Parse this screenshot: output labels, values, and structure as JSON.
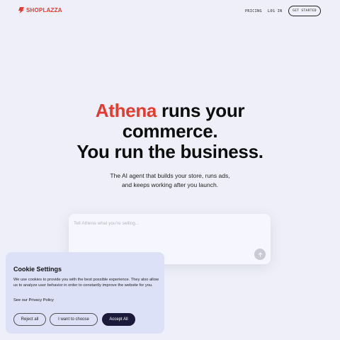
{
  "header": {
    "logo_text": "SHOPLAZZA",
    "logo_icon": "shoplazza-bolt-icon",
    "nav": {
      "pricing": "PRICING",
      "login": "LOG IN",
      "cta": "GET STARTED"
    }
  },
  "hero": {
    "accent": "Athena",
    "line1_rest": " runs your",
    "line2": "commerce.",
    "line3": "You run the business.",
    "subtitle_line1": "The AI agent that builds your store, runs ads,",
    "subtitle_line2": "and keeps working after you launch."
  },
  "prompt": {
    "placeholder": "Tell Athena what you're selling...",
    "value": "",
    "send_icon": "arrow-up-icon"
  },
  "cookie": {
    "title": "Cookie Settings",
    "body": "We use cookies to provide you with the best possible experience. They also allow us to analyze user behavior in order to constantly improve the website for you.",
    "privacy_link": "See our Privacy Policy",
    "buttons": {
      "reject": "Reject all",
      "choose": "I want to choose",
      "accept": "Accept All"
    }
  },
  "colors": {
    "brand": "#e63a2e",
    "background": "#eeeff8",
    "cookie_bg": "#dde1f7",
    "accept_bg": "#1c1a3a"
  }
}
